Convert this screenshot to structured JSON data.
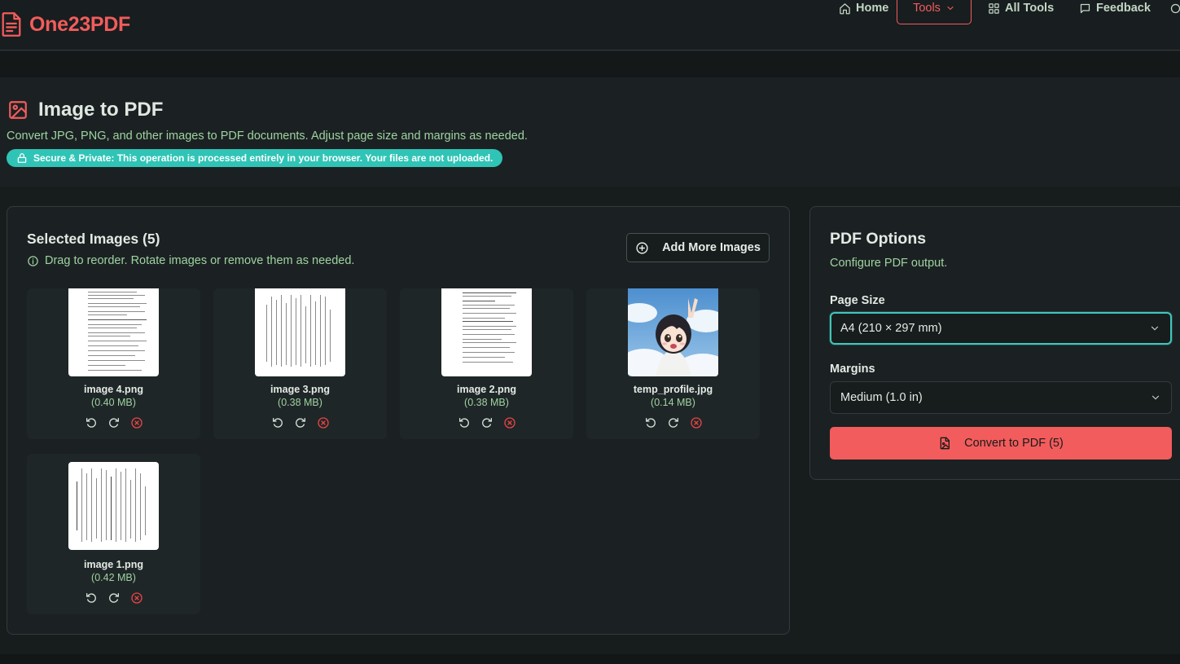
{
  "brand": {
    "name": "One23PDF",
    "color": "#f25c5c"
  },
  "nav": {
    "home": "Home",
    "tools": "Tools",
    "all_tools": "All Tools",
    "feedback": "Feedback"
  },
  "hero": {
    "title": "Image to PDF",
    "description": "Convert JPG, PNG, and other images to PDF documents. Adjust page size and margins as needed.",
    "secure_badge": "Secure & Private: This operation is processed entirely in your browser. Your files are not uploaded."
  },
  "images_panel": {
    "title": "Selected Images (5)",
    "hint": "Drag to reorder. Rotate images or remove them as needed.",
    "add_button": "Add More Images",
    "items": [
      {
        "name": "image 4.png",
        "size": "(0.40 MB)",
        "thumb": "document"
      },
      {
        "name": "image 3.png",
        "size": "(0.38 MB)",
        "thumb": "rotated-document"
      },
      {
        "name": "image 2.png",
        "size": "(0.38 MB)",
        "thumb": "document"
      },
      {
        "name": "temp_profile.jpg",
        "size": "(0.14 MB)",
        "thumb": "anime-girl-sky"
      },
      {
        "name": "image 1.png",
        "size": "(0.42 MB)",
        "thumb": "rotated-document"
      }
    ],
    "item_actions": [
      "rotate-left-icon",
      "rotate-right-icon",
      "remove-icon"
    ]
  },
  "options_panel": {
    "title": "PDF Options",
    "subtitle": "Configure PDF output.",
    "page_size_label": "Page Size",
    "page_size_value": "A4 (210 × 297 mm)",
    "margins_label": "Margins",
    "margins_value": "Medium (1.0 in)",
    "convert_button": "Convert to PDF (5)"
  },
  "colors": {
    "accent": "#f25c5c",
    "secure": "#2fc4b6",
    "focus": "#43c5bb",
    "muted_green": "#9fd3a0"
  }
}
